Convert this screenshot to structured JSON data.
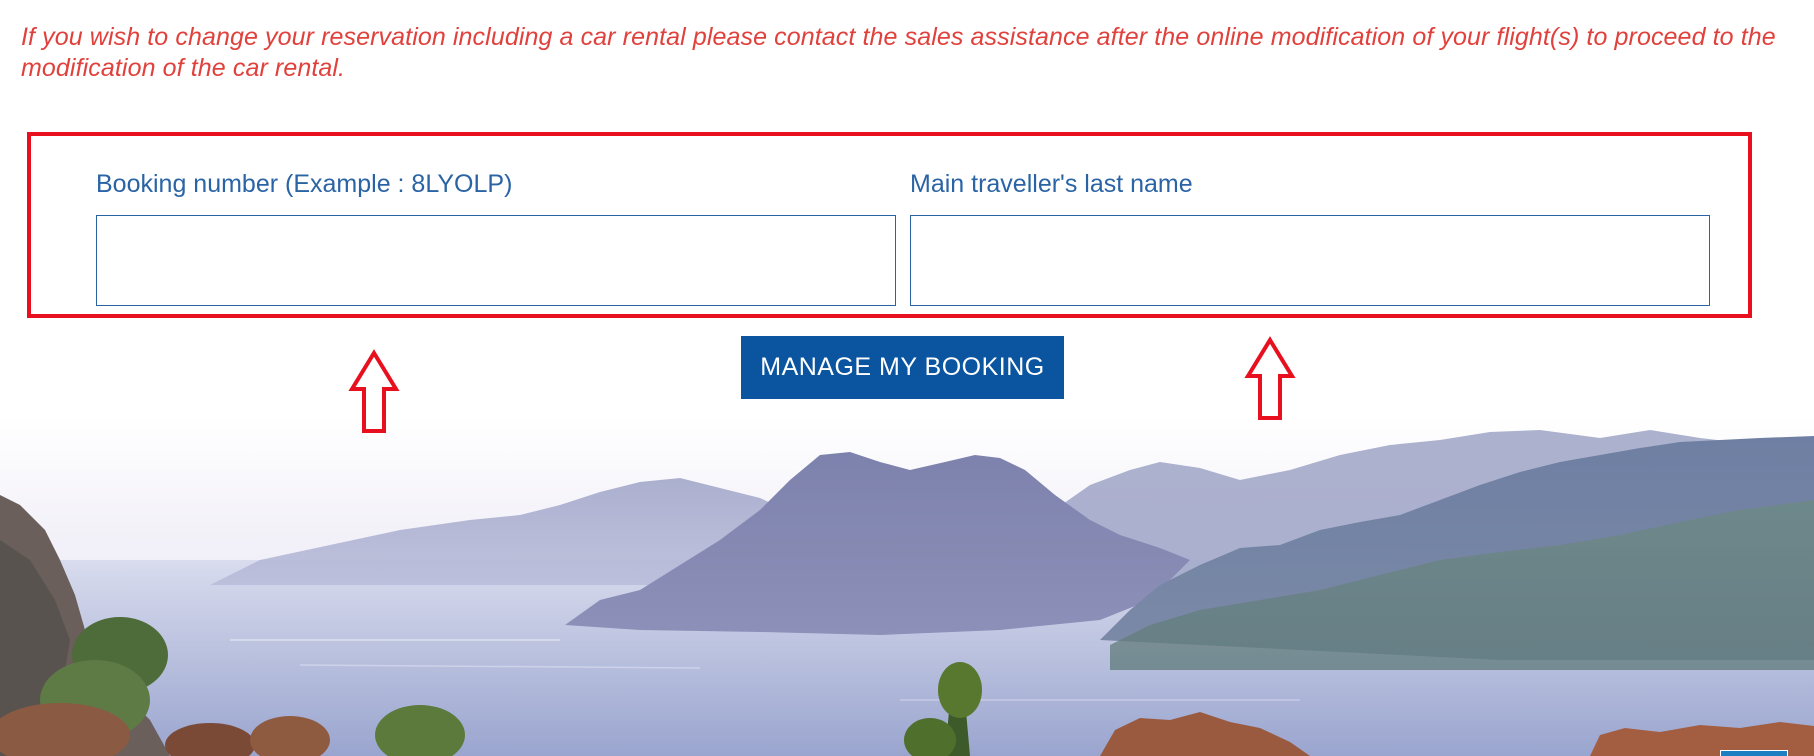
{
  "notice": {
    "text": "If you wish to change your reservation including a car rental please contact the sales assistance after the online modification of your flight(s) to proceed to the modification of the car rental."
  },
  "booking_form": {
    "booking_number": {
      "label": "Booking number (Example : 8LYOLP)",
      "value": "",
      "placeholder": ""
    },
    "last_name": {
      "label": "Main traveller's last name",
      "value": "",
      "placeholder": ""
    },
    "submit_label": "MANAGE MY BOOKING"
  },
  "annotation": {
    "arrow_icon": "up-arrow-outline-icon",
    "highlight_color": "#e8101e"
  },
  "colors": {
    "notice_text": "#e0413c",
    "label_text": "#2a64a5",
    "input_border": "#2a64a5",
    "button_background": "#0a54a0",
    "button_text": "#ffffff"
  },
  "background": {
    "scene": "coastal-mountains-bay-photo"
  }
}
